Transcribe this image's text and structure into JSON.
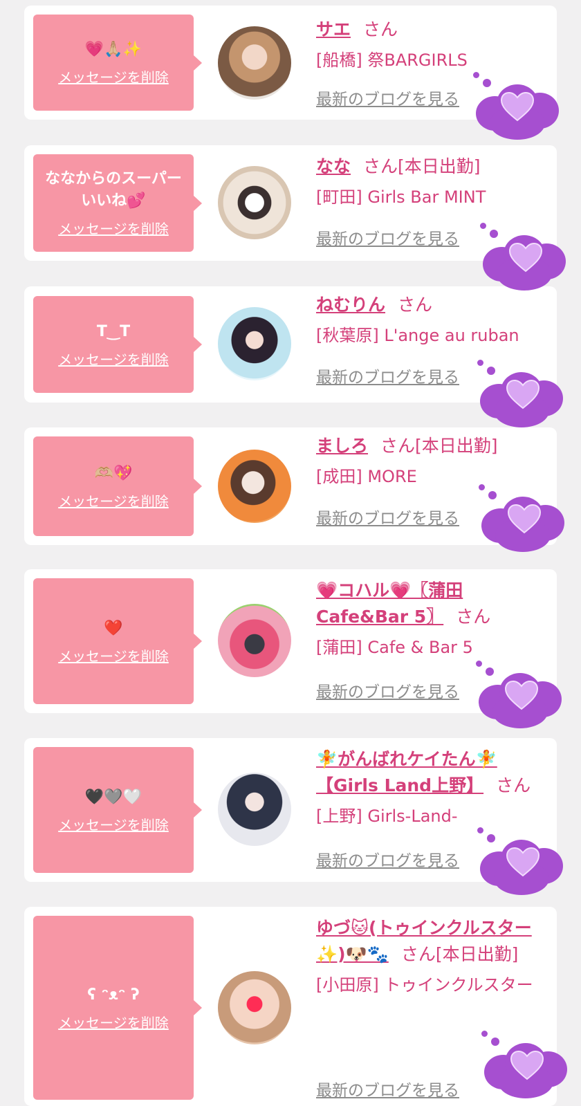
{
  "colors": {
    "accent": "#d4407a",
    "bubble": "#f796a5",
    "cloud": "#a64fd0"
  },
  "delete_label": "メッセージを削除",
  "blog_label": "最新のブログを見る",
  "cards": [
    {
      "message": "💗🙏🏼✨",
      "name": "サエ",
      "suffix": "さん",
      "status": "",
      "shop": "[船橋] 祭BARGIRLS"
    },
    {
      "message": "ななからのスーパーいいね💕",
      "name": "なな",
      "suffix": "さん",
      "status": "[本日出勤]",
      "shop": "[町田] Girls Bar MINT"
    },
    {
      "message": "T‿T",
      "name": "ねむりん",
      "suffix": "さん",
      "status": "",
      "shop": "[秋葉原] L'ange au ruban"
    },
    {
      "message": "🫶🏼💖",
      "name": "ましろ",
      "suffix": "さん",
      "status": "[本日出勤]",
      "shop": "[成田] MORE"
    },
    {
      "message": "❤️",
      "name": "💗コハル💗〖蒲田Cafe&Bar 5〗",
      "suffix": "さん",
      "status": "",
      "shop": "[蒲田] Cafe & Bar 5"
    },
    {
      "message": "🖤🩶🤍",
      "name": "🧚がんばれケイたん🧚【Girls Land上野】",
      "suffix": "さん",
      "status": "",
      "shop": "[上野] Girls-Land-"
    },
    {
      "message": "ʕ ᵔᴥᵔ ʔ",
      "name": "ゆづ🐱(トゥインクルスター✨)🐶🐾",
      "suffix": "さん",
      "status": "[本日出勤]",
      "shop": "[小田原] トゥインクルスター"
    }
  ]
}
